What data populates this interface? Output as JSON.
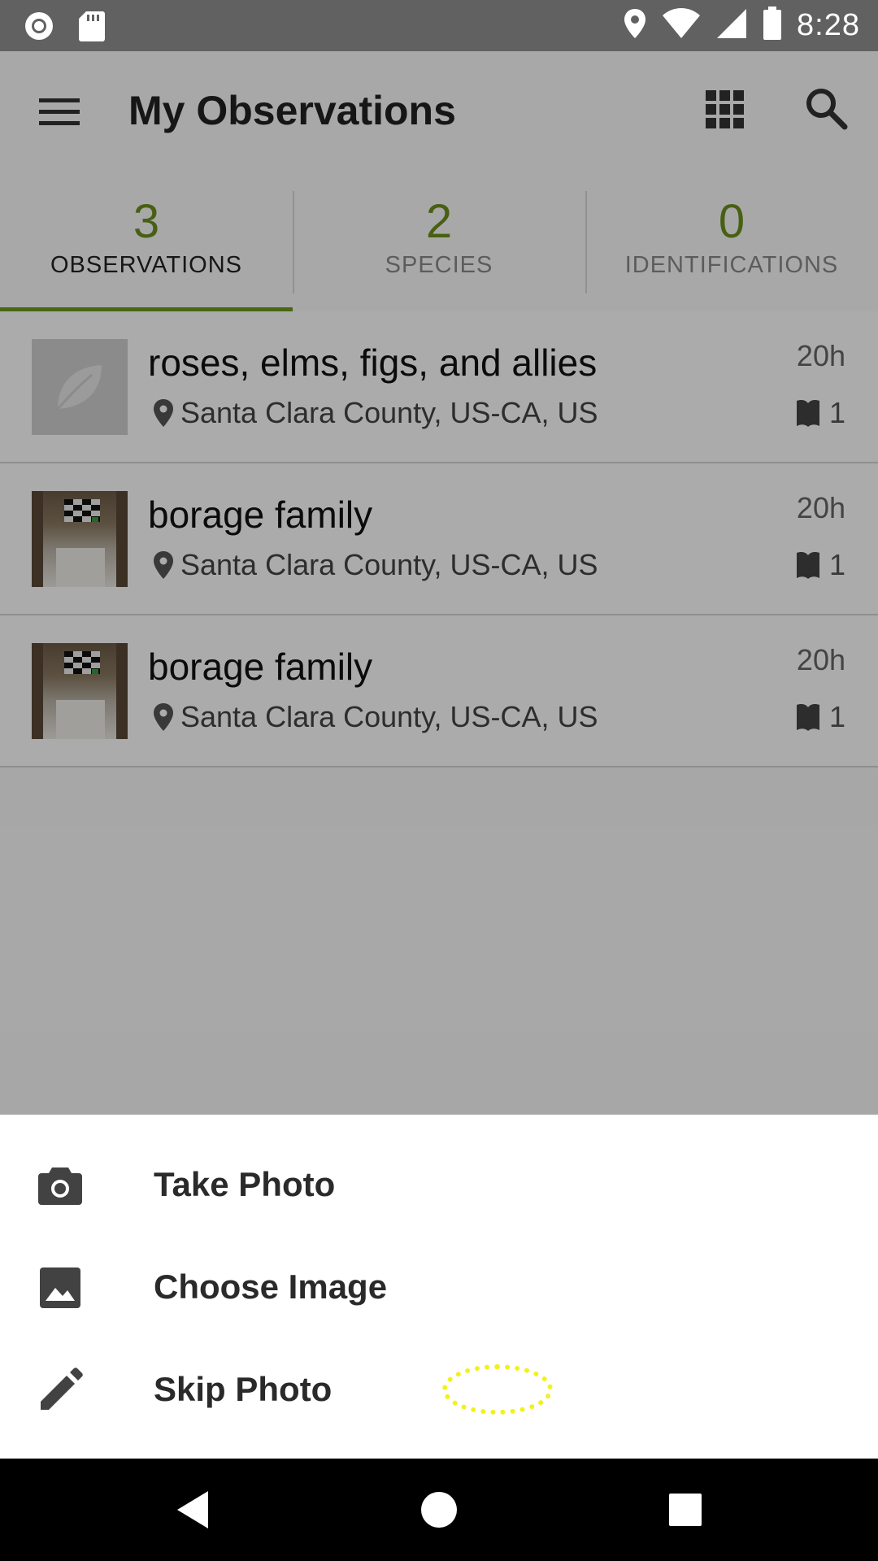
{
  "status_bar": {
    "time": "8:28",
    "left_icons": [
      "record-icon",
      "sd-card-icon"
    ],
    "right_icons": [
      "location-icon",
      "wifi-icon",
      "signal-icon",
      "battery-icon"
    ]
  },
  "app_bar": {
    "title": "My Observations",
    "icons": [
      "menu-icon",
      "grid-view-icon",
      "search-icon"
    ]
  },
  "tabs": [
    {
      "count": "3",
      "label": "OBSERVATIONS",
      "active": true
    },
    {
      "count": "2",
      "label": "SPECIES",
      "active": false
    },
    {
      "count": "0",
      "label": "IDENTIFICATIONS",
      "active": false
    }
  ],
  "observations": [
    {
      "name": "roses, elms, figs, and allies",
      "location": "Santa Clara County, US-CA, US",
      "time": "20h",
      "id_count": "1",
      "thumb": "leaf-placeholder"
    },
    {
      "name": "borage family",
      "location": "Santa Clara County, US-CA, US",
      "time": "20h",
      "id_count": "1",
      "thumb": "photo"
    },
    {
      "name": "borage family",
      "location": "Santa Clara County, US-CA, US",
      "time": "20h",
      "id_count": "1",
      "thumb": "photo"
    }
  ],
  "sheet": {
    "items": [
      {
        "label": "Take Photo",
        "icon": "camera-icon"
      },
      {
        "label": "Choose Image",
        "icon": "image-icon"
      },
      {
        "label": "Skip Photo",
        "icon": "pencil-icon"
      }
    ]
  },
  "nav_bar": {
    "icons": [
      "back-icon",
      "home-icon",
      "recents-icon"
    ]
  },
  "colors": {
    "accent": "#6c9a1e",
    "count": "#6c8f1d",
    "tap_highlight": "#f2f21a"
  }
}
